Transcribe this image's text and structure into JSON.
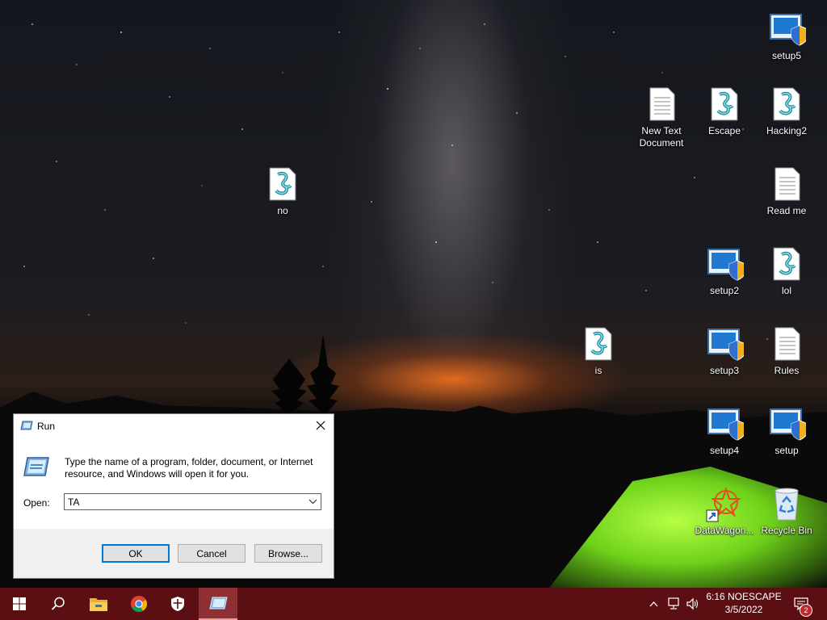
{
  "desktop": {
    "icons": [
      {
        "label": "setup5",
        "type": "setup"
      },
      {
        "label": "New Text Document",
        "type": "text"
      },
      {
        "label": "Escape",
        "type": "script"
      },
      {
        "label": "Hacking2",
        "type": "script"
      },
      {
        "label": "no",
        "type": "script"
      },
      {
        "label": "Read me",
        "type": "text"
      },
      {
        "label": "setup2",
        "type": "setup"
      },
      {
        "label": "lol",
        "type": "script"
      },
      {
        "label": "is",
        "type": "script"
      },
      {
        "label": "setup3",
        "type": "setup"
      },
      {
        "label": "Rules",
        "type": "text"
      },
      {
        "label": "setup4",
        "type": "setup"
      },
      {
        "label": "setup",
        "type": "setup"
      },
      {
        "label": "DataWagon...",
        "type": "shortcut"
      },
      {
        "label": "Recycle Bin",
        "type": "recycle-bin"
      }
    ]
  },
  "run_dialog": {
    "title": "Run",
    "description": "Type the name of a program, folder, document, or Internet resource, and Windows will open it for you.",
    "open_label": "Open:",
    "input_value": "TA",
    "ok_label": "OK",
    "cancel_label": "Cancel",
    "browse_label": "Browse..."
  },
  "taskbar": {
    "items": [
      "start-icon",
      "search-icon",
      "file-explorer-icon",
      "chrome-icon",
      "security-shield-icon",
      "run-app-icon"
    ],
    "active_item": "run-app-icon",
    "clock_time": "6:16 NOESCAPE",
    "clock_date": "3/5/2022",
    "notification_count": "2",
    "accent_color": "#5c0f12"
  }
}
